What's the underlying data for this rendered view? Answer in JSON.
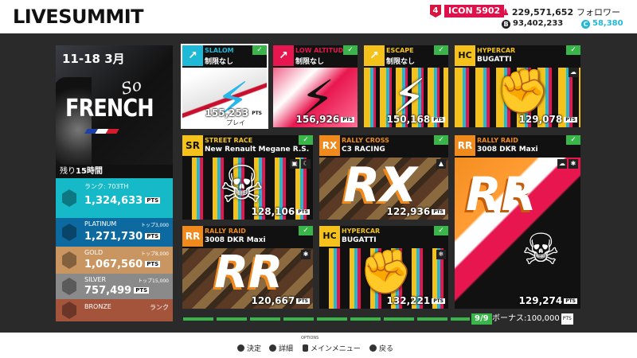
{
  "header": {
    "logo_text": "LIVESUMMIT",
    "icon_level": "4",
    "icon_label": "ICON 5902",
    "followers_value": "229,571,652",
    "followers_suffix": "フォロワー",
    "credits_value": "93,402,233",
    "cc_value": "58,380"
  },
  "summit": {
    "date": "11-18 3月",
    "theme_so": "So",
    "theme_main": "FRENCH",
    "time_remaining_prefix": "残り",
    "time_remaining_value": "15時間",
    "tiers": [
      {
        "name": "ランク: 703TH",
        "points": "1,324,633",
        "rank_label": ""
      },
      {
        "name": "PLATINUM",
        "points": "1,271,730",
        "rank_label": "トップ3,000"
      },
      {
        "name": "GOLD",
        "points": "1,067,560",
        "rank_label": "トップ8,000"
      },
      {
        "name": "SILVER",
        "points": "757,499",
        "rank_label": "トップ15,000"
      },
      {
        "name": "BRONZE",
        "points": "",
        "rank_label": "ランク"
      }
    ],
    "pts_unit": "PTS"
  },
  "events": [
    {
      "type": "SLALOM",
      "sub": "制限なし",
      "points": "155,253",
      "note": "プレイ",
      "chip": "↗",
      "color": "#1fb9d8"
    },
    {
      "type": "LOW ALTITUDE",
      "sub": "制限なし",
      "points": "156,926",
      "note": "",
      "chip": "↗",
      "color": "#e8164f"
    },
    {
      "type": "ESCAPE",
      "sub": "制限なし",
      "points": "150,168",
      "note": "",
      "chip": "↗",
      "color": "#f4c21a"
    },
    {
      "type": "HYPERCAR",
      "sub": "BUGATTI",
      "points": "129,078",
      "note": "",
      "chip": "HC",
      "color": "#f4c21a"
    },
    {
      "type": "STREET RACE",
      "sub": "New Renault Megane R.S.",
      "points": "128,106",
      "note": "",
      "chip": "SR",
      "color": "#f4c21a"
    },
    {
      "type": "RALLY CROSS",
      "sub": "C3 RACING",
      "points": "122,936",
      "note": "",
      "chip": "RX",
      "color": "#f08a1c"
    },
    {
      "type": "RALLY RAID",
      "sub": "3008 DKR Maxi",
      "points": "129,274",
      "note": "",
      "chip": "RR",
      "color": "#f08a1c"
    },
    {
      "type": "RALLY RAID",
      "sub": "3008 DKR Maxi",
      "points": "120,667",
      "note": "",
      "chip": "RR",
      "color": "#f08a1c"
    },
    {
      "type": "HYPERCAR",
      "sub": "BUGATTI",
      "points": "132,221",
      "note": "",
      "chip": "HC",
      "color": "#f4c21a"
    }
  ],
  "progress": {
    "count": "9/9",
    "bonus_label": "ボーナス:",
    "bonus_value": "100,000",
    "completed_fraction": 1.0
  },
  "footer": {
    "select": "決定",
    "details": "詳細",
    "options_tag": "OPTIONS",
    "main_menu": "メインメニュー",
    "back": "戻る"
  }
}
